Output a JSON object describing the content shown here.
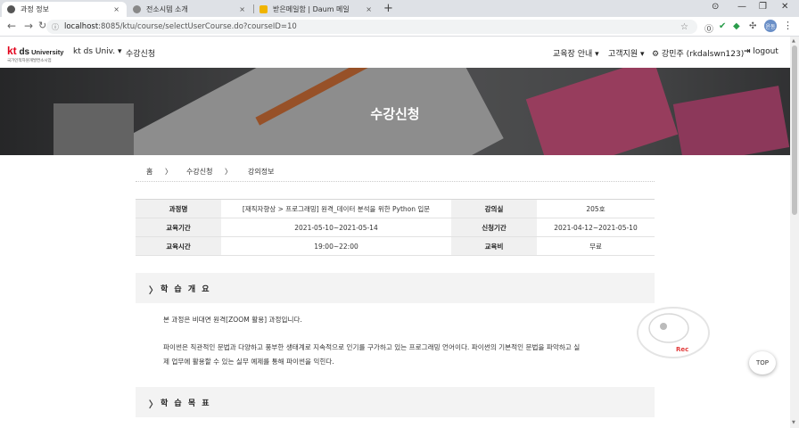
{
  "browser": {
    "tabs": [
      {
        "title": "과정 정보",
        "active": true,
        "favicon_color": "#555555"
      },
      {
        "title": "전소시템 소개",
        "active": false,
        "favicon_color": "#888888"
      },
      {
        "title": "받은메일함 | Daum 메일",
        "active": false,
        "favicon_color": "#f0b400"
      }
    ],
    "new_tab": "+",
    "tab_close": "×",
    "window_controls": [
      "⊙",
      "—",
      "❐",
      "✕"
    ],
    "url_host": "localhost",
    "url_rest": ":8085/ktu/course/selectUserCourse.do?courseID=10",
    "profile_initials": "윤동"
  },
  "site": {
    "logo_kt": "kt",
    "logo_ds": " ds",
    "logo_university": "University",
    "logo_sub": "국가인적자원개발컨소시엄",
    "brand_menu": "kt ds Univ. ▾",
    "page_link": "수강신청",
    "nav_items": [
      "교육장 안내 ▾",
      "고객지원 ▾"
    ],
    "user": "⚙ 강민주 (rkdalswn123)",
    "logout": "logout"
  },
  "hero": {
    "title": "수강신청"
  },
  "breadcrumb": [
    "홈",
    "〉",
    "수강신청",
    "〉",
    "강의정보"
  ],
  "course": {
    "rows": [
      {
        "label1": "과정명",
        "value1": "[재직자향상 > 프로그래밍] 원격_데이터 분석을 위한 Python 입문",
        "label2": "강의실",
        "value2": "205호"
      },
      {
        "label1": "교육기간",
        "value1": "2021-05-10~2021-05-14",
        "label2": "신청기간",
        "value2": "2021-04-12~2021-05-10"
      },
      {
        "label1": "교육시간",
        "value1": "19:00~22:00",
        "label2": "교육비",
        "value2": "무료"
      }
    ]
  },
  "sections": {
    "overview_title": "학 습 개 요",
    "overview_p1": "본 과정은 비대면 원격[ZOOM 활용] 과정입니다.",
    "overview_p2_line1": "파이썬은 직관적인 문법과 다양하고 풍부한 생태계로 지속적으로 인기를 구가하고 있는 프로그래밍 언어이다. 파이썬의 기본적인 문법을 파악하고 실",
    "overview_p2_line2": "제 업무에 활용할 수 있는 실무 예제를 통해 파이썬을 익힌다.",
    "goal_title": "학 습 목 표"
  },
  "floating": {
    "rec": "Rec",
    "top": "TOP"
  }
}
